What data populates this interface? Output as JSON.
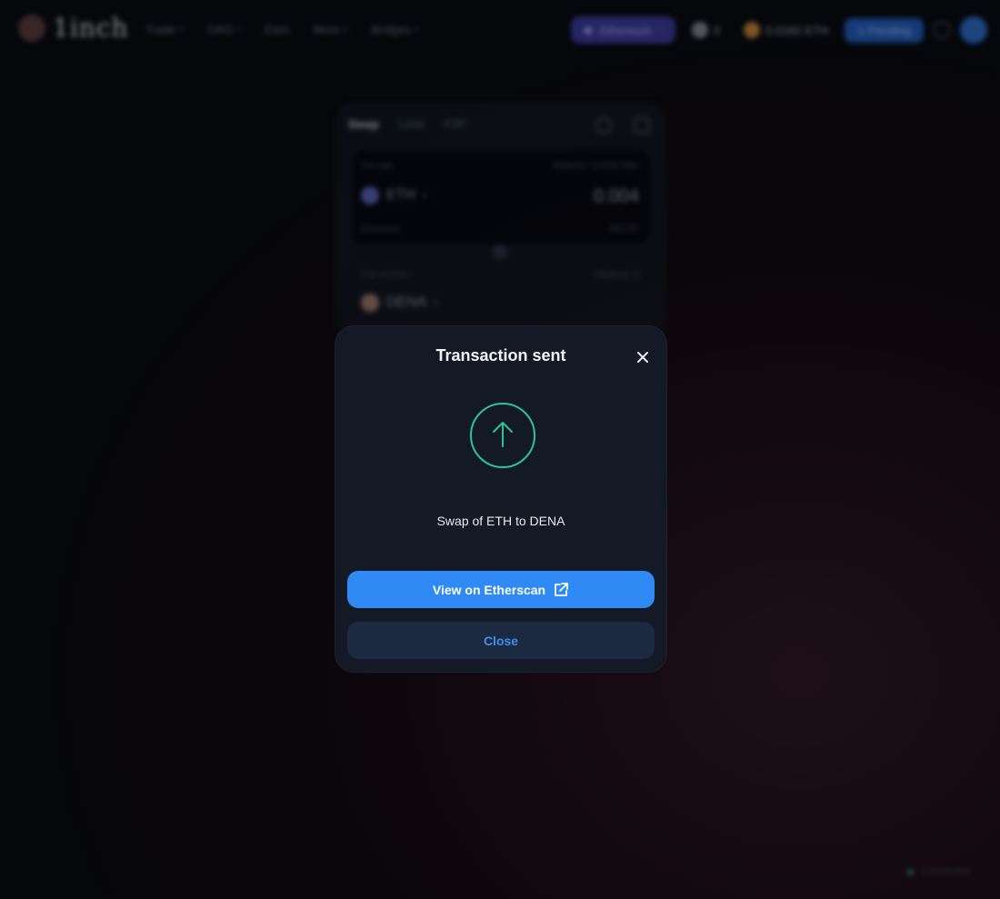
{
  "brand": {
    "name": "1inch"
  },
  "nav": [
    {
      "label": "Trade"
    },
    {
      "label": "DAO"
    },
    {
      "label": "Earn"
    },
    {
      "label": "More"
    },
    {
      "label": "Bridges"
    }
  ],
  "header": {
    "network": "Ethereum",
    "wallet_count": "0",
    "balance": "0.0182 ETH",
    "pending": "1 Pending"
  },
  "swap": {
    "tabs": [
      "Swap",
      "Limit",
      "P2P"
    ],
    "you_pay_label": "You pay",
    "balance_label": "Balance: 0.0182 Max",
    "from_token": "ETH",
    "amount": "0.004",
    "from_sub": "Ethereum",
    "from_value": "~$12.97",
    "you_receive_label": "You receive",
    "receive_balance": "Balance: 0",
    "to_token": "DENA"
  },
  "status_chip": "Connected",
  "modal": {
    "title": "Transaction sent",
    "message": "Swap of ETH to DENA",
    "primary_label": "View on Etherscan",
    "secondary_label": "Close"
  },
  "colors": {
    "accent": "#2f8af5",
    "success": "#2fc29a",
    "modal_bg": "#131a25",
    "secondary_btn_bg": "#1b2a40"
  }
}
